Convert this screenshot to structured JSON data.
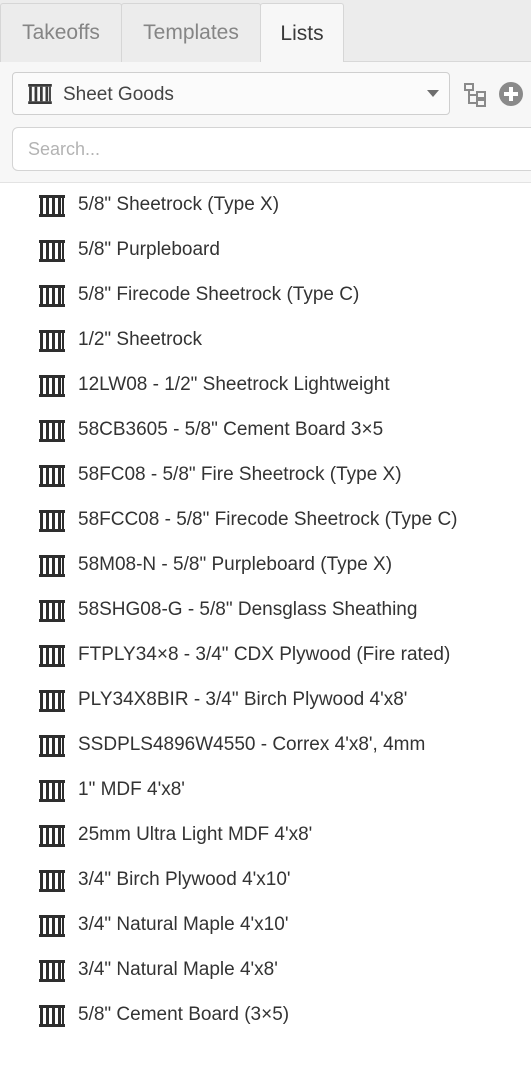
{
  "tabs": [
    {
      "label": "Takeoffs",
      "active": false
    },
    {
      "label": "Templates",
      "active": false
    },
    {
      "label": "Lists",
      "active": true
    }
  ],
  "list_selector": {
    "icon": "barcode-icon",
    "value": "Sheet Goods"
  },
  "actions": {
    "tree_icon": "hierarchy-tree-icon",
    "add_icon": "plus-circle-icon"
  },
  "search": {
    "placeholder": "Search...",
    "value": ""
  },
  "items": [
    {
      "label": "5/8\" Sheetrock (Type X)",
      "icon": "barcode-icon"
    },
    {
      "label": "5/8\" Purpleboard",
      "icon": "barcode-icon"
    },
    {
      "label": "5/8\" Firecode Sheetrock (Type C)",
      "icon": "barcode-icon"
    },
    {
      "label": "1/2\" Sheetrock",
      "icon": "barcode-icon"
    },
    {
      "label": "12LW08 - 1/2\" Sheetrock Lightweight",
      "icon": "barcode-icon"
    },
    {
      "label": "58CB3605 - 5/8\" Cement Board 3×5",
      "icon": "barcode-icon"
    },
    {
      "label": "58FC08 - 5/8\" Fire Sheetrock (Type X)",
      "icon": "barcode-icon"
    },
    {
      "label": "58FCC08 - 5/8\" Firecode Sheetrock (Type C)",
      "icon": "barcode-icon"
    },
    {
      "label": "58M08-N - 5/8\" Purpleboard (Type X)",
      "icon": "barcode-icon"
    },
    {
      "label": "58SHG08-G - 5/8\" Densglass Sheathing",
      "icon": "barcode-icon"
    },
    {
      "label": "FTPLY34×8 - 3/4\" CDX Plywood (Fire rated)",
      "icon": "barcode-icon"
    },
    {
      "label": "PLY34X8BIR - 3/4\" Birch Plywood 4'x8'",
      "icon": "barcode-icon"
    },
    {
      "label": "SSDPLS4896W4550 - Correx 4'x8', 4mm",
      "icon": "barcode-icon"
    },
    {
      "label": "1\" MDF 4'x8'",
      "icon": "barcode-icon"
    },
    {
      "label": "25mm Ultra Light MDF 4'x8'",
      "icon": "barcode-icon"
    },
    {
      "label": "3/4\" Birch Plywood 4'x10'",
      "icon": "barcode-icon"
    },
    {
      "label": "3/4\" Natural Maple 4'x10'",
      "icon": "barcode-icon"
    },
    {
      "label": "3/4\" Natural Maple 4'x8'",
      "icon": "barcode-icon"
    },
    {
      "label": "5/8\" Cement Board (3×5)",
      "icon": "barcode-icon"
    }
  ]
}
